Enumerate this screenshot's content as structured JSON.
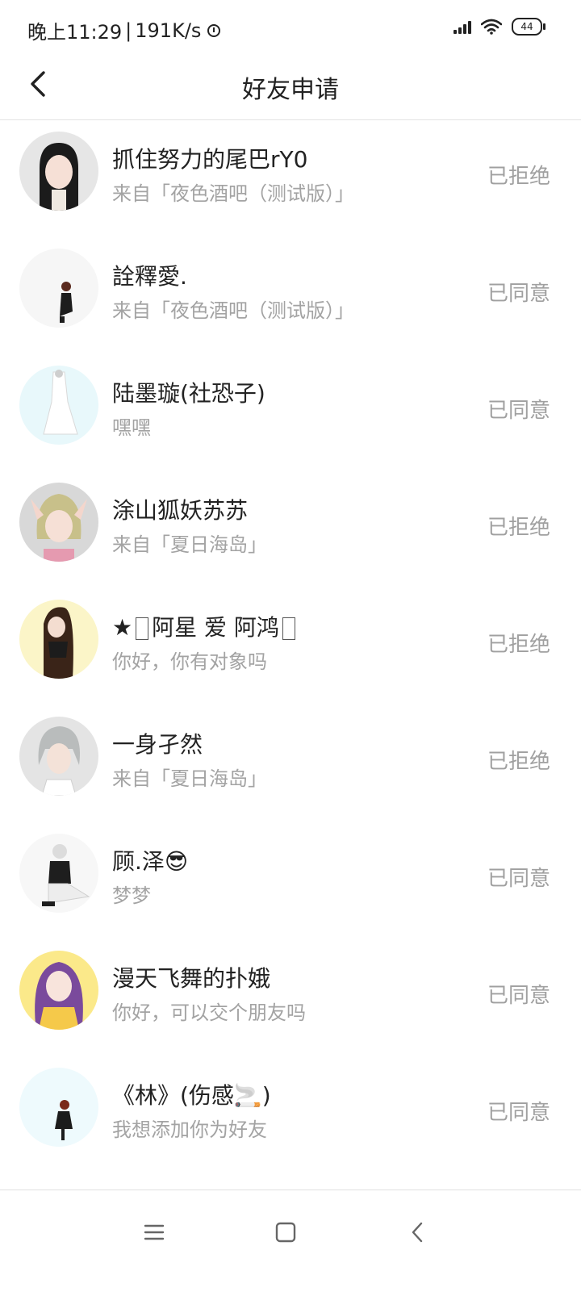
{
  "status_bar": {
    "time": "晚上11:29",
    "speed": "191K/s",
    "battery": "44"
  },
  "header": {
    "title": "好友申请"
  },
  "requests": [
    {
      "name": "抓住努力的尾巴rY0",
      "subtitle": "来自「夜色酒吧（测试版）」",
      "status": "已拒绝",
      "avatar_color": "#e6e6e6"
    },
    {
      "name": "詮釋愛.",
      "subtitle": "来自「夜色酒吧（测试版）」",
      "status": "已同意",
      "avatar_color": "#f6f6f6"
    },
    {
      "name": "陆墨璇(社恐子)",
      "subtitle": "嘿嘿",
      "status": "已同意",
      "avatar_color": "#e8f8fb"
    },
    {
      "name": "涂山狐妖苏苏",
      "subtitle": "来自「夏日海岛」",
      "status": "已拒绝",
      "avatar_color": "#d8d8d8"
    },
    {
      "name_parts": [
        "★",
        "阿星 爱 阿鸿"
      ],
      "subtitle": "你好，你有对象吗",
      "status": "已拒绝",
      "avatar_color": "#fbf5c8"
    },
    {
      "name": "一身孑然",
      "subtitle": "来自「夏日海岛」",
      "status": "已拒绝",
      "avatar_color": "#e4e4e4"
    },
    {
      "name": "顾.泽😎",
      "subtitle": "梦梦",
      "status": "已同意",
      "avatar_color": "#f7f7f7"
    },
    {
      "name": "漫天飞舞的扑娥",
      "subtitle": "你好，可以交个朋友吗",
      "status": "已同意",
      "avatar_color": "#fbe98a"
    },
    {
      "name": "《林》(伤感🚬)",
      "subtitle": "我想添加你为好友",
      "status": "已同意",
      "avatar_color": "#eefafd"
    }
  ],
  "nav_icons": [
    "menu-icon",
    "home-square-icon",
    "back-triangle-icon"
  ]
}
